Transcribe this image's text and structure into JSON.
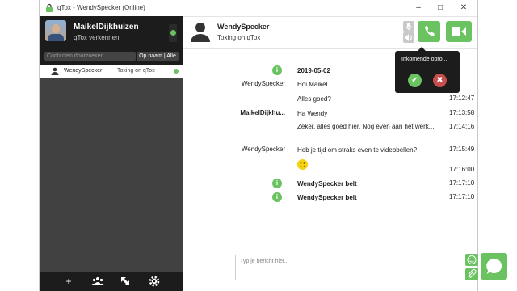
{
  "window": {
    "title": "qTox - WendySpecker (Online)"
  },
  "profile": {
    "name": "MaikelDijkhuizen",
    "status": "qTox verkennen"
  },
  "search": {
    "placeholder": "Contacten doorzoeken",
    "sort_label": "Op naam | Alle"
  },
  "contacts": [
    {
      "name": "WendySpecker",
      "status": "Toxing on qTox",
      "online": true
    }
  ],
  "chat": {
    "name": "WendySpecker",
    "status": "Toxing on qTox",
    "incoming_call": {
      "label": "Inkomende opro..."
    },
    "messages": [
      {
        "sender": "",
        "text": "2019-05-02",
        "time": "",
        "type": "info"
      },
      {
        "sender": "WendySpecker",
        "text": "Hoi Maikel",
        "time": "",
        "type": "msg"
      },
      {
        "sender": "",
        "text": "Alles goed?",
        "time": "17:12:47",
        "type": "msg"
      },
      {
        "sender": "MaikelDijkhu...",
        "text": "Ha Wendy",
        "time": "17:13:58",
        "type": "msg"
      },
      {
        "sender": "",
        "text": "Zeker, alles goed hier. Nog even aan het werk...",
        "time": "17:14:16",
        "type": "msg"
      },
      {
        "sender": "WendySpecker",
        "text": "Heb je tijd om straks even te videobellen?",
        "time": "17:15:49",
        "type": "msg"
      },
      {
        "sender": "",
        "text": "",
        "time": "17:16:00",
        "type": "emoji"
      },
      {
        "sender": "",
        "text": "WendySpecker belt",
        "time": "17:17:10",
        "type": "info"
      },
      {
        "sender": "",
        "text": "WendySpecker belt",
        "time": "17:17:10",
        "type": "info"
      }
    ],
    "input_placeholder": "Typ je bericht hier..."
  },
  "colors": {
    "accent": "#6bc260",
    "sidebar_dark": "#1c1c1c",
    "sidebar": "#414141",
    "reject": "#c84e4e"
  }
}
